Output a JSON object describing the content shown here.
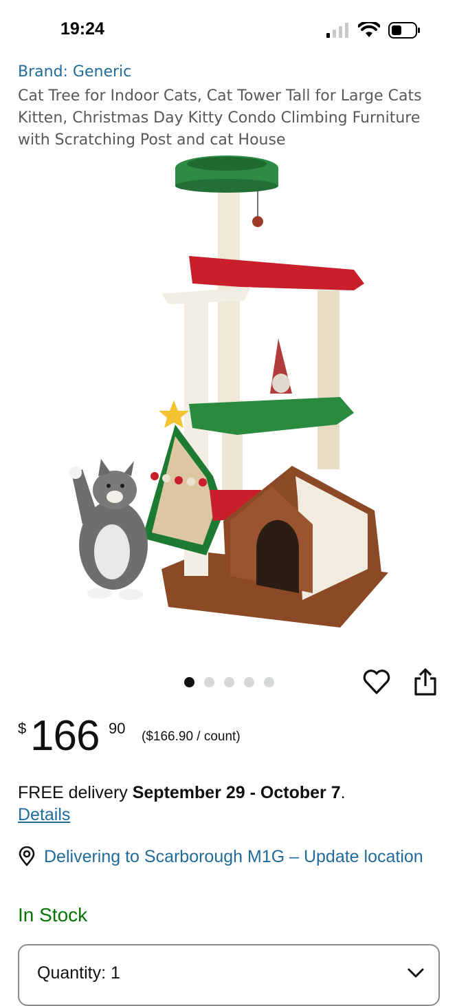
{
  "status": {
    "time": "19:24"
  },
  "product": {
    "brand": "Brand: Generic",
    "title": "Cat Tree for Indoor Cats, Cat Tower Tall for Large Cats Kitten, Christmas Day Kitty Condo Climbing Furniture with Scratching Post and cat House"
  },
  "gallery": {
    "image_count": 5,
    "active_index": 0
  },
  "actions": {
    "favorite_icon": "heart-icon",
    "share_icon": "share-icon"
  },
  "price": {
    "symbol": "$",
    "whole": "166",
    "fraction": "90",
    "unit_price": "($166.90 / count)"
  },
  "delivery": {
    "prefix": "FREE delivery ",
    "dates": "September 29 - October 7",
    "suffix": ".",
    "details_link": "Details"
  },
  "location": {
    "text": "Delivering to Scarborough M1G – Update location",
    "icon": "location-pin-icon"
  },
  "stock": "In Stock",
  "quantity": {
    "label": "Quantity:",
    "value": "1"
  }
}
